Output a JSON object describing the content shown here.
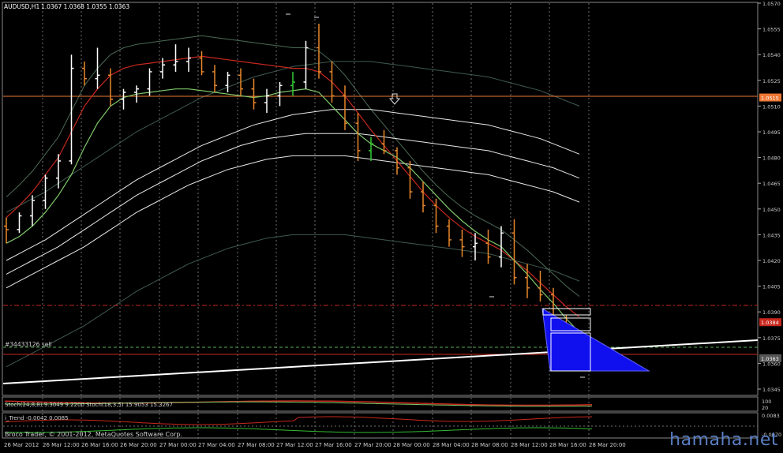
{
  "window": {
    "title": "AUDUSD,H1",
    "ohlc": "1.0367 1.0368 1.0355 1.0363"
  },
  "copyright": "Broco Trader, © 2001-2012, MetaQuotes Software Corp.",
  "watermark": "hamaha.net",
  "order_label": "#34433126 sell",
  "colors": {
    "background": "#000000",
    "up_bar": "#ffffff",
    "down_bar": "#e8882b",
    "green_bar": "#33cc33",
    "red_line": "#c8281e",
    "green_line": "#7fc96a",
    "white_band": "#e8e8e8",
    "gray_band": "#3f5a4f",
    "triangle": "#1010ee",
    "orange_hline": "#ee7733",
    "grid": "#6f6f6f"
  },
  "indicators": {
    "stoch_label": "Stoch(24,8,8) 9.3049 9.2200  Stoch(18,3,5) 15.9053 15.3267",
    "stoch_scale": [
      "100",
      "20"
    ],
    "itrend_label": "i_Trend -0.0042 0.0085",
    "itrend_scale": [
      "0.0083",
      "-0.0070"
    ]
  },
  "chart_data": {
    "type": "candlestick",
    "symbol": "AUDUSD",
    "timeframe": "H1",
    "y_ticks": [
      "1.0570",
      "1.0555",
      "1.0540",
      "1.0525",
      "1.0510",
      "1.0495",
      "1.0480",
      "1.0465",
      "1.0450",
      "1.0435",
      "1.0420",
      "1.0405",
      "1.0390",
      "1.0375",
      "1.0360",
      "1.0345"
    ],
    "price_tags": [
      {
        "value": "1.0515",
        "color": "#ee7733"
      },
      {
        "value": "1.0384",
        "color": "#c8281e"
      },
      {
        "value": "1.0363",
        "color": "#555555"
      }
    ],
    "x_labels": [
      "26 Mar 2012",
      "26 Mar 12:00",
      "26 Mar 16:00",
      "26 Mar 20:00",
      "27 Mar 00:00",
      "27 Mar 04:00",
      "27 Mar 08:00",
      "27 Mar 12:00",
      "27 Mar 16:00",
      "27 Mar 20:00",
      "28 Mar 00:00",
      "28 Mar 04:00",
      "28 Mar 08:00",
      "28 Mar 12:00",
      "28 Mar 16:00",
      "28 Mar 20:00"
    ],
    "bars": [
      [
        1.044,
        1.0445,
        1.043,
        1.0438
      ],
      [
        1.0438,
        1.0448,
        1.0436,
        1.0446
      ],
      [
        1.0446,
        1.0458,
        1.044,
        1.0455
      ],
      [
        1.0455,
        1.047,
        1.045,
        1.0468
      ],
      [
        1.0468,
        1.0482,
        1.0462,
        1.0478
      ],
      [
        1.0478,
        1.054,
        1.0476,
        1.0532
      ],
      [
        1.0532,
        1.0536,
        1.0522,
        1.0526
      ],
      [
        1.0526,
        1.0544,
        1.052,
        1.0528
      ],
      [
        1.0528,
        1.0532,
        1.051,
        1.0514
      ],
      [
        1.0514,
        1.052,
        1.0508,
        1.0518
      ],
      [
        1.0518,
        1.0522,
        1.0512,
        1.052
      ],
      [
        1.052,
        1.0532,
        1.0516,
        1.053
      ],
      [
        1.053,
        1.0538,
        1.0526,
        1.0534
      ],
      [
        1.0534,
        1.0546,
        1.053,
        1.0536
      ],
      [
        1.0536,
        1.0544,
        1.053,
        1.0538
      ],
      [
        1.0538,
        1.0542,
        1.0528,
        1.053
      ],
      [
        1.053,
        1.0534,
        1.0518,
        1.0522
      ],
      [
        1.0522,
        1.053,
        1.0518,
        1.0528
      ],
      [
        1.0528,
        1.0532,
        1.0516,
        1.052
      ],
      [
        1.052,
        1.0526,
        1.0508,
        1.0512
      ],
      [
        1.0512,
        1.052,
        1.0506,
        1.0516
      ],
      [
        1.0516,
        1.0524,
        1.051,
        1.0522
      ],
      [
        1.0522,
        1.053,
        1.0516,
        1.0524
      ],
      [
        1.0524,
        1.0548,
        1.052,
        1.0544
      ],
      [
        1.0544,
        1.0558,
        1.0526,
        1.053
      ],
      [
        1.053,
        1.0536,
        1.0512,
        1.0516
      ],
      [
        1.0516,
        1.0522,
        1.0496,
        1.05
      ],
      [
        1.05,
        1.0506,
        1.0478,
        1.0484
      ],
      [
        1.0484,
        1.0492,
        1.0478,
        1.0488
      ],
      [
        1.0488,
        1.0496,
        1.0482,
        1.0484
      ],
      [
        1.0484,
        1.0486,
        1.047,
        1.0474
      ],
      [
        1.0474,
        1.0478,
        1.0456,
        1.046
      ],
      [
        1.046,
        1.0466,
        1.0448,
        1.0452
      ],
      [
        1.0452,
        1.0456,
        1.0436,
        1.044
      ],
      [
        1.044,
        1.0444,
        1.0428,
        1.0432
      ],
      [
        1.0432,
        1.0438,
        1.0422,
        1.0428
      ],
      [
        1.0428,
        1.0436,
        1.042,
        1.043
      ],
      [
        1.043,
        1.0438,
        1.0418,
        1.0422
      ],
      [
        1.0422,
        1.044,
        1.0416,
        1.0436
      ],
      [
        1.0436,
        1.0444,
        1.0406,
        1.041
      ],
      [
        1.041,
        1.0418,
        1.0398,
        1.0404
      ],
      [
        1.0404,
        1.0414,
        1.0396,
        1.04
      ],
      [
        1.04,
        1.0404,
        1.038,
        1.0384
      ],
      [
        1.0384,
        1.0388,
        1.0368,
        1.0372
      ],
      [
        1.0372,
        1.0378,
        1.0358,
        1.0363
      ]
    ],
    "red_ma": [
      1.0445,
      1.0452,
      1.046,
      1.047,
      1.048,
      1.0495,
      1.051,
      1.052,
      1.0528,
      1.0532,
      1.0534,
      1.0535,
      1.0536,
      1.0537,
      1.0538,
      1.0539,
      1.0538,
      1.0537,
      1.0536,
      1.0535,
      1.0534,
      1.0533,
      1.0532,
      1.0532,
      1.053,
      1.0524,
      1.0516,
      1.0506,
      1.0496,
      1.0487,
      1.0478,
      1.0469,
      1.046,
      1.0452,
      1.0445,
      1.0439,
      1.0434,
      1.043,
      1.0426,
      1.042,
      1.0414,
      1.0407,
      1.04,
      1.0393,
      1.0387
    ],
    "green_ma": [
      1.043,
      1.0434,
      1.044,
      1.0448,
      1.0458,
      1.047,
      1.0486,
      1.05,
      1.051,
      1.0515,
      1.0517,
      1.0518,
      1.0519,
      1.052,
      1.052,
      1.0519,
      1.0518,
      1.0517,
      1.0516,
      1.0515,
      1.0516,
      1.0518,
      1.0519,
      1.052,
      1.0518,
      1.051,
      1.0502,
      1.0494,
      1.0488,
      1.0484,
      1.048,
      1.0474,
      1.0466,
      1.0458,
      1.045,
      1.0443,
      1.0437,
      1.0432,
      1.0428,
      1.042,
      1.0412,
      1.0403,
      1.0395,
      1.0386,
      1.0378
    ],
    "white_upper": [
      1.042,
      1.0424,
      1.0428,
      1.0432,
      1.0437,
      1.0442,
      1.0447,
      1.0452,
      1.0457,
      1.0462,
      1.0467,
      1.0471,
      1.0475,
      1.0479,
      1.0483,
      1.0487,
      1.049,
      1.0493,
      1.0496,
      1.0499,
      1.0501,
      1.0503,
      1.0505,
      1.0506,
      1.0507,
      1.0508,
      1.0508,
      1.0508,
      1.0508,
      1.0507,
      1.0506,
      1.0505,
      1.0504,
      1.0503,
      1.0502,
      1.0501,
      1.05,
      1.0499,
      1.0497,
      1.0495,
      1.0493,
      1.0491,
      1.0488,
      1.0485,
      1.0482
    ],
    "white_mid": [
      1.0412,
      1.0416,
      1.042,
      1.0424,
      1.0428,
      1.0433,
      1.0438,
      1.0443,
      1.0448,
      1.0453,
      1.0458,
      1.0462,
      1.0466,
      1.047,
      1.0474,
      1.0478,
      1.0481,
      1.0484,
      1.0487,
      1.0489,
      1.0491,
      1.0492,
      1.0493,
      1.0494,
      1.0494,
      1.0494,
      1.0494,
      1.0494,
      1.0493,
      1.0492,
      1.0491,
      1.049,
      1.0489,
      1.0488,
      1.0487,
      1.0486,
      1.0485,
      1.0484,
      1.0482,
      1.048,
      1.0478,
      1.0476,
      1.0474,
      1.0471,
      1.0468
    ],
    "white_lower": [
      1.0404,
      1.0408,
      1.0412,
      1.0416,
      1.042,
      1.0424,
      1.0428,
      1.0433,
      1.0438,
      1.0443,
      1.0448,
      1.0452,
      1.0456,
      1.046,
      1.0464,
      1.0467,
      1.047,
      1.0473,
      1.0475,
      1.0477,
      1.0479,
      1.048,
      1.0481,
      1.0481,
      1.0481,
      1.0481,
      1.0481,
      1.048,
      1.0479,
      1.0478,
      1.0477,
      1.0476,
      1.0475,
      1.0474,
      1.0473,
      1.0472,
      1.0471,
      1.047,
      1.0468,
      1.0466,
      1.0464,
      1.0462,
      1.046,
      1.0457,
      1.0454
    ]
  }
}
